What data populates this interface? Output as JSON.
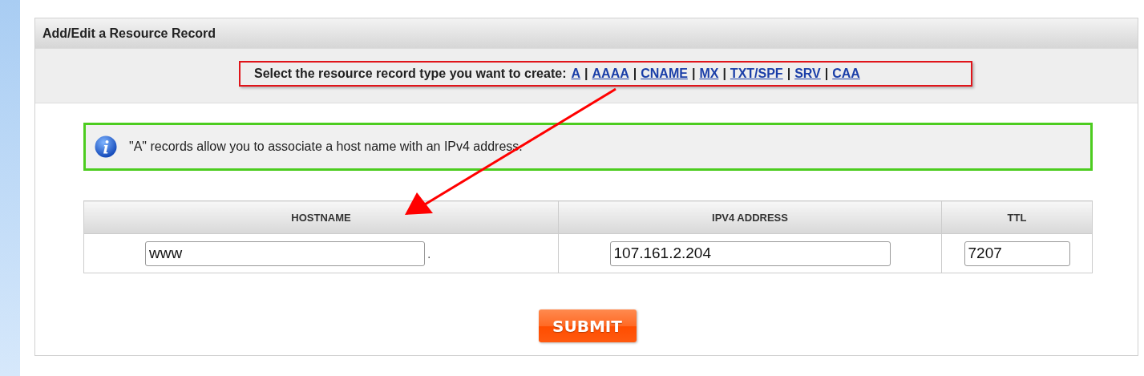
{
  "panel": {
    "title": "Add/Edit a Resource Record"
  },
  "record_types": {
    "prompt": "Select the resource record type you want to create:",
    "types": [
      "A",
      "AAAA",
      "CNAME",
      "MX",
      "TXT/SPF",
      "SRV",
      "CAA"
    ],
    "separator": "|"
  },
  "info": {
    "message": "\"A\" records allow you to associate a host name with an IPv4 address."
  },
  "table": {
    "columns": [
      "HOSTNAME",
      "IPV4 ADDRESS",
      "TTL"
    ],
    "row": {
      "hostname": "www",
      "domain_suffix": ".",
      "ipv4": "107.161.2.204",
      "ttl": "7207"
    }
  },
  "submit": {
    "label": "SUBMIT"
  }
}
